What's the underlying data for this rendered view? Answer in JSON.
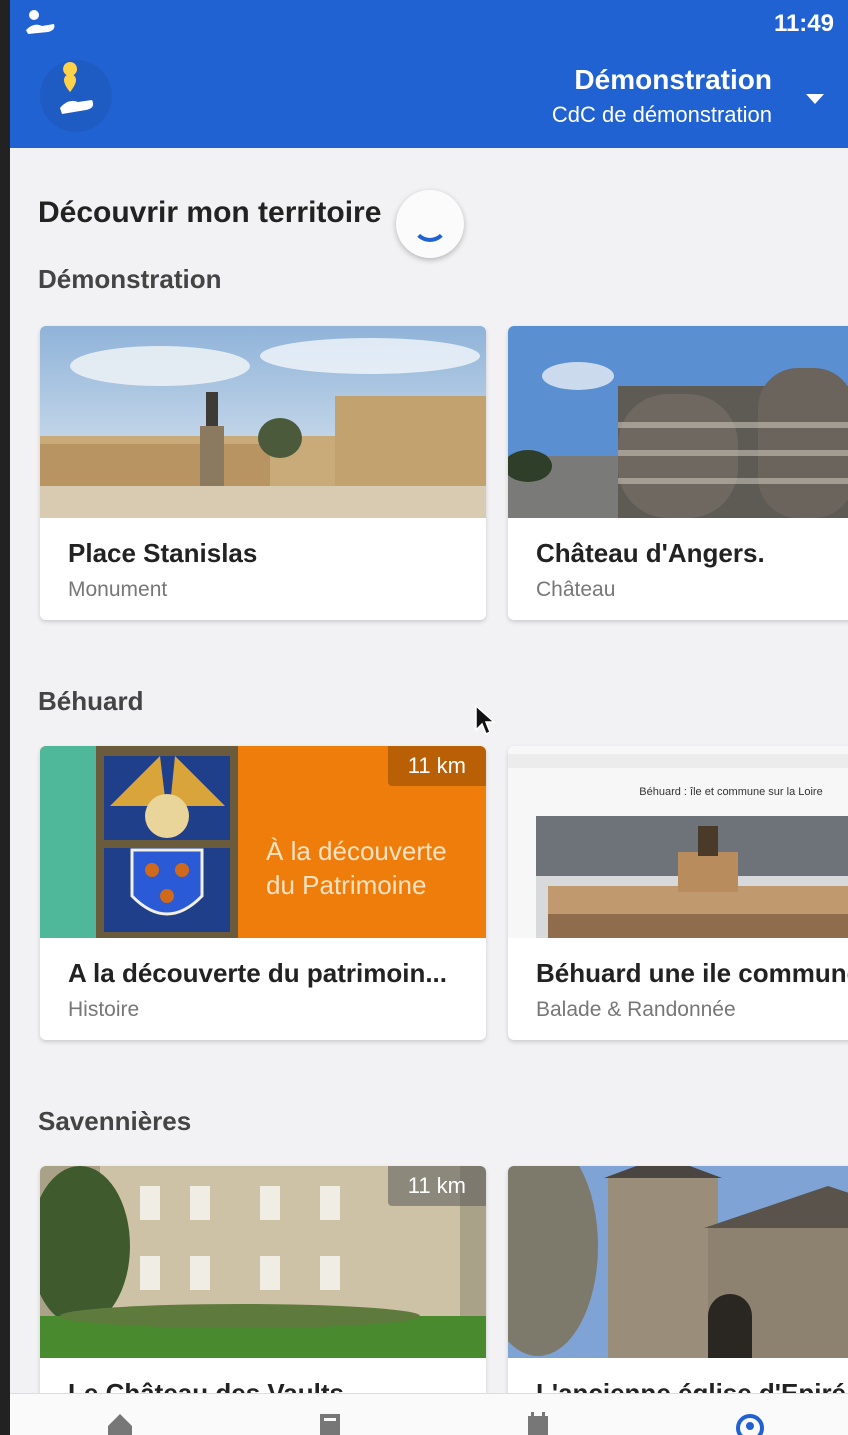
{
  "status_bar": {
    "time": "11:49"
  },
  "app_bar": {
    "title": "Démonstration",
    "subtitle": "CdC de démonstration",
    "logo_icon": "map-pin-hand-icon",
    "dropdown_icon": "caret-down-icon"
  },
  "page": {
    "title": "Découvrir mon territoire"
  },
  "sections": [
    {
      "title": "Démonstration",
      "cards": [
        {
          "name": "Place Stanislas",
          "category": "Monument"
        },
        {
          "name": "Château d'Angers.",
          "category": "Château"
        }
      ]
    },
    {
      "title": "Béhuard",
      "cards": [
        {
          "name": "A la découverte du patrimoin...",
          "category": "Histoire",
          "distance": "11 km",
          "image_text_line1": "À la découverte",
          "image_text_line2": "du Patrimoine"
        },
        {
          "name": "Béhuard une ile commune sur la Loire",
          "category": "Balade & Randonnée",
          "image_text": "Béhuard : île et commune sur la Loire"
        }
      ]
    },
    {
      "title": "Savennières",
      "cards": [
        {
          "name": "Le Château des Vaults",
          "category": "",
          "distance": "11 km"
        },
        {
          "name": "L'ancienne église d'Epiré",
          "category": ""
        }
      ]
    }
  ],
  "bottom_nav": [
    {
      "icon": "home-icon"
    },
    {
      "icon": "news-icon"
    },
    {
      "icon": "calendar-icon"
    },
    {
      "icon": "profile-icon"
    }
  ],
  "colors": {
    "primary": "#2062d1",
    "background": "#f2f2f4",
    "orange": "#ef7d0b",
    "teal": "#4fb89a"
  }
}
